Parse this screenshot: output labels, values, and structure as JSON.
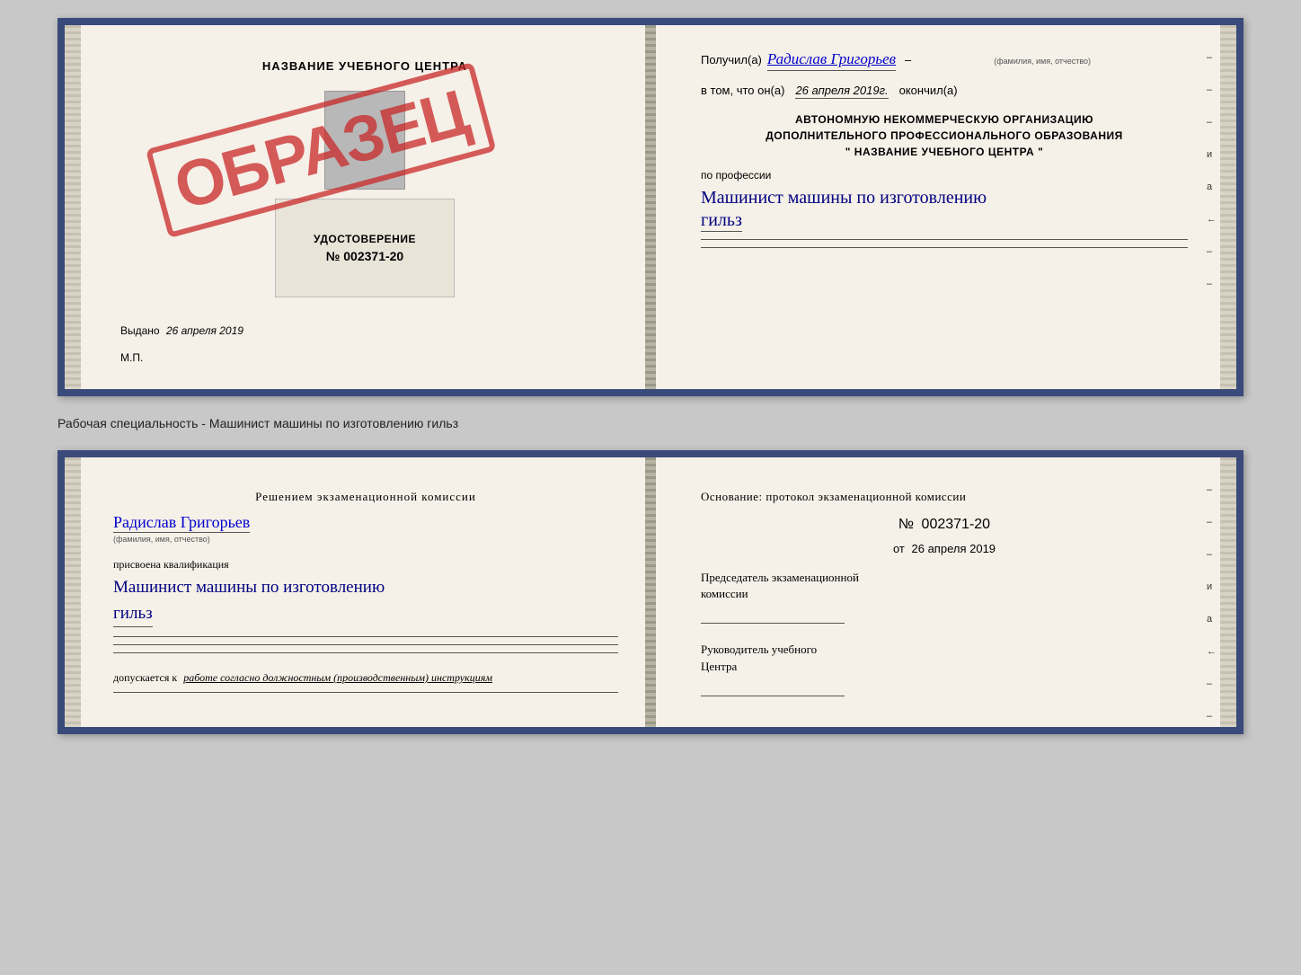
{
  "top_doc": {
    "left": {
      "school_name": "НАЗВАНИЕ УЧЕБНОГО ЦЕНТРА",
      "obrazets": "ОБРАЗЕЦ",
      "cert_title": "УДОСТОВЕРЕНИЕ",
      "cert_number": "№ 002371-20",
      "vydano_label": "Выдано",
      "vydano_date": "26 апреля 2019",
      "mp_label": "М.П."
    },
    "right": {
      "poluchil_prefix": "Получил(а)",
      "poluchil_name": "Радислав Григорьев",
      "fio_label": "(фамилия, имя, отчество)",
      "dash": "–",
      "vtom_prefix": "в том, что он(а)",
      "vtom_date": "26 апреля 2019г.",
      "okonchil": "окончил(а)",
      "org_line1": "АВТОНОМНУЮ НЕКОММЕРЧЕСКУЮ ОРГАНИЗАЦИЮ",
      "org_line2": "ДОПОЛНИТЕЛЬНОГО ПРОФЕССИОНАЛЬНОГО ОБРАЗОВАНИЯ",
      "org_quote_open": "\"",
      "org_name": "НАЗВАНИЕ УЧЕБНОГО ЦЕНТРА",
      "org_quote_close": "\"",
      "po_professii": "по профессии",
      "profession_line1": "Машинист машины по изготовлению",
      "profession_line2": "гильз"
    }
  },
  "between_label": "Рабочая специальность - Машинист машины по изготовлению гильз",
  "bottom_doc": {
    "left": {
      "resheniem": "Решением  экзаменационной  комиссии",
      "name_handwritten": "Радислав Григорьев",
      "fio_label": "(фамилия, имя, отчество)",
      "prisvoena": "присвоена квалификация",
      "profession_line1": "Машинист  машины  по изготовлению",
      "profession_line2": "гильз",
      "dopuskaetsya_prefix": "допускается к",
      "dopuskaetsya_text": "работе согласно должностным (производственным) инструкциям"
    },
    "right": {
      "osnovanie": "Основание:  протокол  экзаменационной  комиссии",
      "protocol_prefix": "№",
      "protocol_number": "002371-20",
      "ot_prefix": "от",
      "ot_date": "26 апреля 2019",
      "predsedatel_line1": "Председатель экзаменационной",
      "predsedatel_line2": "комиссии",
      "rukovoditel_line1": "Руководитель учебного",
      "rukovoditel_line2": "Центра"
    }
  },
  "right_marks": {
    "mark1": "–",
    "mark2": "–",
    "mark3": "–",
    "mark4": "и",
    "mark5": "а",
    "mark6": "←",
    "mark7": "–",
    "mark8": "–",
    "mark9": "–"
  }
}
